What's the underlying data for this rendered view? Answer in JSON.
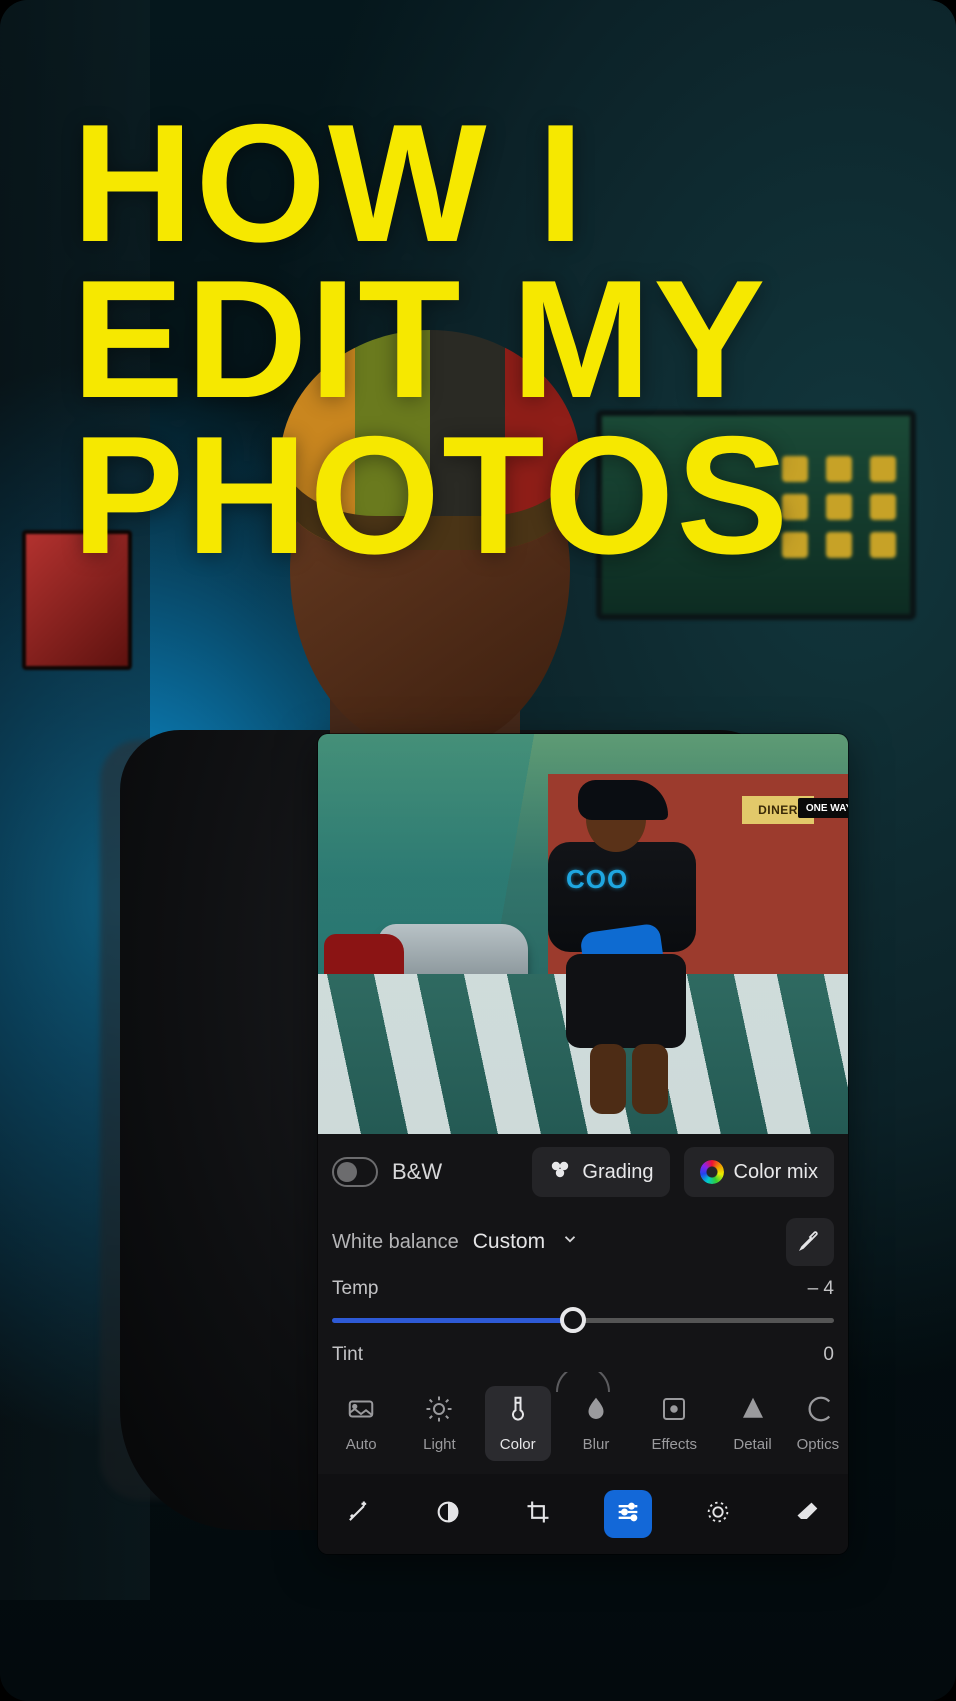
{
  "headline": "HOW I EDIT MY PHOTOS",
  "preview": {
    "diner_sign": "DINER",
    "oneway_sign": "ONE WAY",
    "shirt_text": "COO"
  },
  "color_panel": {
    "bw_label": "B&W",
    "grading_label": "Grading",
    "colormix_label": "Color mix",
    "wb_label": "White balance",
    "wb_value": "Custom",
    "temp_label": "Temp",
    "temp_value": "– 4",
    "tint_label": "Tint",
    "tint_value": "0"
  },
  "categories": {
    "auto": "Auto",
    "light": "Light",
    "color": "Color",
    "blur": "Blur",
    "effects": "Effects",
    "detail": "Detail",
    "optics": "Optics"
  }
}
